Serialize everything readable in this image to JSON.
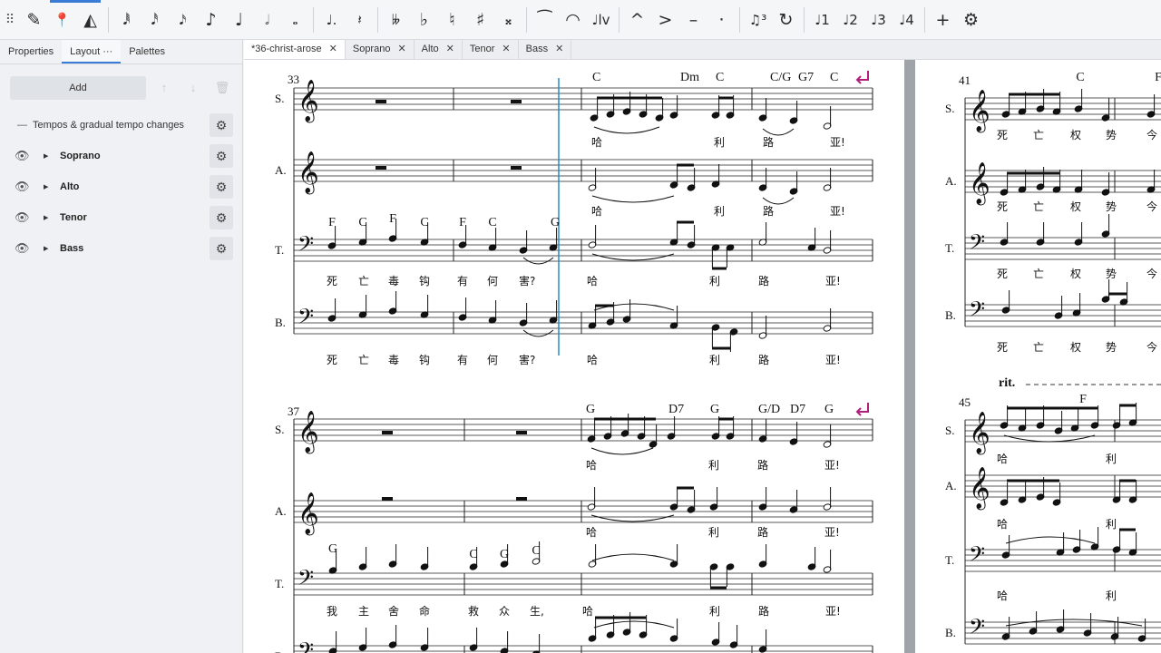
{
  "toolbar": {
    "items": [
      {
        "name": "pen-icon",
        "glyph": "✎"
      },
      {
        "name": "pin-icon",
        "glyph": "📍"
      },
      {
        "name": "metronome-icon",
        "glyph": "◭"
      },
      {
        "sep": true
      },
      {
        "name": "note-64th-icon",
        "glyph": "𝅘𝅥𝅱"
      },
      {
        "name": "note-32nd-icon",
        "glyph": "𝅘𝅥𝅰"
      },
      {
        "name": "note-16th-icon",
        "glyph": "𝅘𝅥𝅯"
      },
      {
        "name": "note-8th-icon",
        "glyph": "♪"
      },
      {
        "name": "note-quarter-icon",
        "glyph": "♩"
      },
      {
        "name": "note-half-icon",
        "glyph": "𝅗𝅥"
      },
      {
        "name": "note-whole-icon",
        "glyph": "𝅝"
      },
      {
        "sep": true
      },
      {
        "name": "dot-icon",
        "glyph": "♩."
      },
      {
        "name": "rest-icon",
        "glyph": "𝄽"
      },
      {
        "sep": true
      },
      {
        "name": "double-flat-icon",
        "glyph": "𝄫"
      },
      {
        "name": "flat-icon",
        "glyph": "♭"
      },
      {
        "name": "natural-icon",
        "glyph": "♮"
      },
      {
        "name": "sharp-icon",
        "glyph": "♯"
      },
      {
        "name": "double-sharp-icon",
        "glyph": "𝄪"
      },
      {
        "sep": true
      },
      {
        "name": "tie-icon",
        "glyph": "⁀"
      },
      {
        "name": "slur-icon",
        "glyph": "◠"
      },
      {
        "name": "let-ring-icon",
        "glyph": "♩lv"
      },
      {
        "sep": true
      },
      {
        "name": "marcato-icon",
        "glyph": "^"
      },
      {
        "name": "accent-icon",
        "glyph": ">"
      },
      {
        "name": "tenuto-icon",
        "glyph": "–"
      },
      {
        "name": "staccato-icon",
        "glyph": "·"
      },
      {
        "sep": true
      },
      {
        "name": "tuplet-icon",
        "glyph": "♫³"
      },
      {
        "name": "flip-icon",
        "glyph": "↻"
      },
      {
        "sep": true
      },
      {
        "name": "voice-1-icon",
        "glyph": "♩1"
      },
      {
        "name": "voice-2-icon",
        "glyph": "♩2"
      },
      {
        "name": "voice-3-icon",
        "glyph": "♩3"
      },
      {
        "name": "voice-4-icon",
        "glyph": "♩4"
      },
      {
        "sep": true
      },
      {
        "name": "add-icon",
        "glyph": "+"
      },
      {
        "name": "settings-icon",
        "glyph": "⚙"
      }
    ]
  },
  "panel": {
    "tabs": [
      {
        "label": "Properties",
        "active": false
      },
      {
        "label": "Layout  ···",
        "active": true
      },
      {
        "label": "Palettes",
        "active": false
      }
    ],
    "add_label": "Add",
    "tempo_row": "Tempos & gradual tempo changes",
    "rows": [
      "Soprano",
      "Alto",
      "Tenor",
      "Bass"
    ]
  },
  "score_tabs": [
    {
      "label": "*36-christ-arose",
      "active": true
    },
    {
      "label": "Soprano",
      "active": false
    },
    {
      "label": "Alto",
      "active": false
    },
    {
      "label": "Tenor",
      "active": false
    },
    {
      "label": "Bass",
      "active": false
    }
  ],
  "score": {
    "staff_labels": [
      "S.",
      "A.",
      "T.",
      "B."
    ],
    "measure_numbers": [
      "33",
      "37",
      "41",
      "45"
    ],
    "rit": "rit.",
    "chords_sys1_upper": [
      "C",
      "Dm",
      "C",
      "C/G",
      "G7",
      "C"
    ],
    "chords_sys1_tenor": [
      "F",
      "C",
      "F",
      "C",
      "F",
      "C",
      "G"
    ],
    "chords_sys2_upper": [
      "G",
      "D7",
      "G",
      "G/D",
      "D7",
      "G"
    ],
    "chords_sys2_tenor": [
      "G",
      "C",
      "G",
      "C"
    ],
    "chords_p2": [
      "C",
      "F",
      "F"
    ],
    "lyrics_upper": [
      "哈",
      "利",
      "路",
      "亚!"
    ],
    "lyrics_tenor1": [
      "死",
      "亡",
      "毒",
      "钩",
      "有",
      "何",
      "害?",
      "哈",
      "利",
      "路",
      "亚!"
    ],
    "lyrics_tenor2": [
      "我",
      "主",
      "舍",
      "命",
      "救",
      "众",
      "生,",
      "哈",
      "利",
      "路",
      "亚!"
    ],
    "lyrics_p2": [
      "死",
      "亡",
      "权",
      "势",
      "今"
    ],
    "lyrics_p2_short": [
      "哈",
      "利"
    ]
  }
}
